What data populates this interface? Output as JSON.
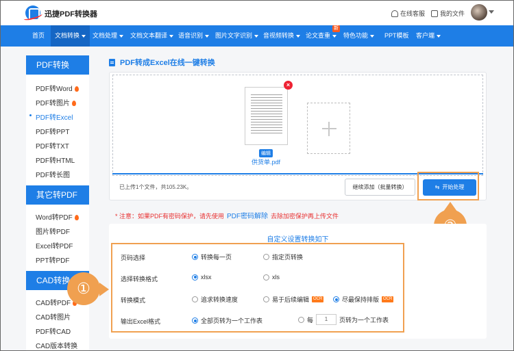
{
  "header": {
    "brand": "迅捷PDF转换器",
    "service_label": "在线客服",
    "files_label": "我的文件"
  },
  "nav": {
    "items": [
      {
        "label": "首页",
        "dropdown": false
      },
      {
        "label": "文档转换",
        "dropdown": true,
        "active": true
      },
      {
        "label": "文档处理",
        "dropdown": true
      },
      {
        "label": "文档文本翻译",
        "dropdown": true
      },
      {
        "label": "语音识别",
        "dropdown": true
      },
      {
        "label": "图片文字识别",
        "dropdown": true
      },
      {
        "label": "音视频转换",
        "dropdown": true
      },
      {
        "label": "论文查重",
        "dropdown": true,
        "badge": "新"
      },
      {
        "label": "特色功能",
        "dropdown": true
      },
      {
        "label": "PPT模板",
        "dropdown": false
      },
      {
        "label": "客户端",
        "dropdown": true
      }
    ]
  },
  "sidebar": {
    "sections": [
      {
        "title": "PDF转换",
        "items": [
          {
            "label": "PDF转Word",
            "hot": true
          },
          {
            "label": "PDF转图片",
            "hot": true
          },
          {
            "label": "PDF转Excel",
            "active": true
          },
          {
            "label": "PDF转PPT"
          },
          {
            "label": "PDF转TXT"
          },
          {
            "label": "PDF转HTML"
          },
          {
            "label": "PDF转长图"
          }
        ]
      },
      {
        "title": "其它转PDF",
        "items": [
          {
            "label": "Word转PDF",
            "hot": true
          },
          {
            "label": "图片转PDF"
          },
          {
            "label": "Excel转PDF"
          },
          {
            "label": "PPT转PDF"
          }
        ]
      },
      {
        "title": "CAD转换",
        "items": [
          {
            "label": "CAD转PDF",
            "hot": true
          },
          {
            "label": "CAD转图片"
          },
          {
            "label": "PDF转CAD"
          },
          {
            "label": "CAD版本转换"
          }
        ]
      }
    ]
  },
  "main": {
    "title": "PDF转成Excel在线一键转换",
    "file": {
      "edit_label": "编辑",
      "name": "供货单.pdf",
      "delete_symbol": "×"
    },
    "upload_info": "已上传1个文件，共105.23K。",
    "continue_button": "继续添加（批量转换）",
    "start_button": "开始处理",
    "start_symbol": "⇆",
    "note": {
      "prefix": "* 注意：如果PDF有密码保护，请先使用",
      "link": "PDF密码解除",
      "suffix": "去除加密保护再上传文件"
    },
    "settings": {
      "title": "自定义设置转换如下",
      "rows": [
        {
          "label": "页码选择",
          "options": [
            "转换每一页",
            "指定页转换"
          ],
          "selected": 0
        },
        {
          "label": "选择转换格式",
          "options": [
            "xlsx",
            "xls"
          ],
          "selected": 0
        },
        {
          "label": "转换模式",
          "options": [
            "追求转换速度",
            "易于后续编辑",
            "尽最保持排版"
          ],
          "ocr": [
            false,
            true,
            true
          ],
          "selected": 2
        },
        {
          "label": "输出Excel格式",
          "options": [
            "全部页转为一个工作表",
            "每"
          ],
          "selected": 0,
          "per_page_value": "1",
          "per_page_suffix": "页转为一个工作表"
        }
      ]
    }
  },
  "annotations": {
    "step1": "①",
    "step2": "②",
    "highlight_color": "#f0a050"
  },
  "colors": {
    "brand_blue": "#1e7ee6",
    "nav_active": "#1566c4",
    "warning_red": "#e83030",
    "hot_orange": "#ff6a1a"
  }
}
